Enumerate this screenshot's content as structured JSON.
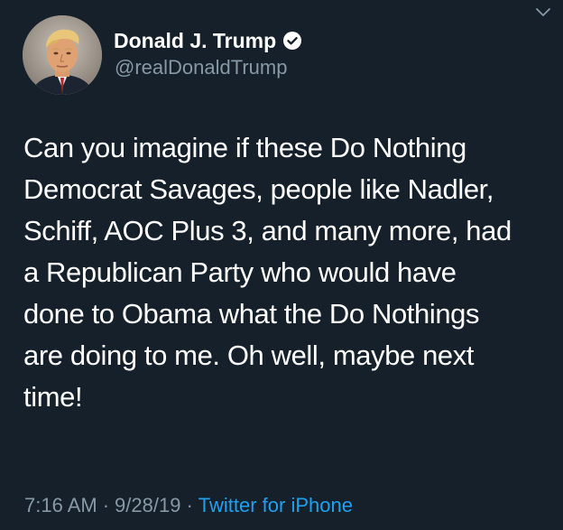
{
  "tweet": {
    "display_name": "Donald J. Trump",
    "handle": "@realDonaldTrump",
    "verified": true,
    "verified_icon": "verified-badge-icon",
    "menu_icon": "chevron-down-icon",
    "text": "Can you imagine if these Do Nothing\nDemocrat Savages, people like Nadler,\nSchiff, AOC Plus 3, and many more, had\na Republican Party who would have\ndone to Obama what the Do Nothings\nare doing to me. Oh well, maybe next\ntime!",
    "time": "7:16 AM",
    "date": "9/28/19",
    "separator": "·",
    "source": "Twitter for iPhone"
  },
  "colors": {
    "background": "#15202b",
    "primary_text": "#ffffff",
    "secondary_text": "#8899a6",
    "link": "#1da1f2"
  }
}
